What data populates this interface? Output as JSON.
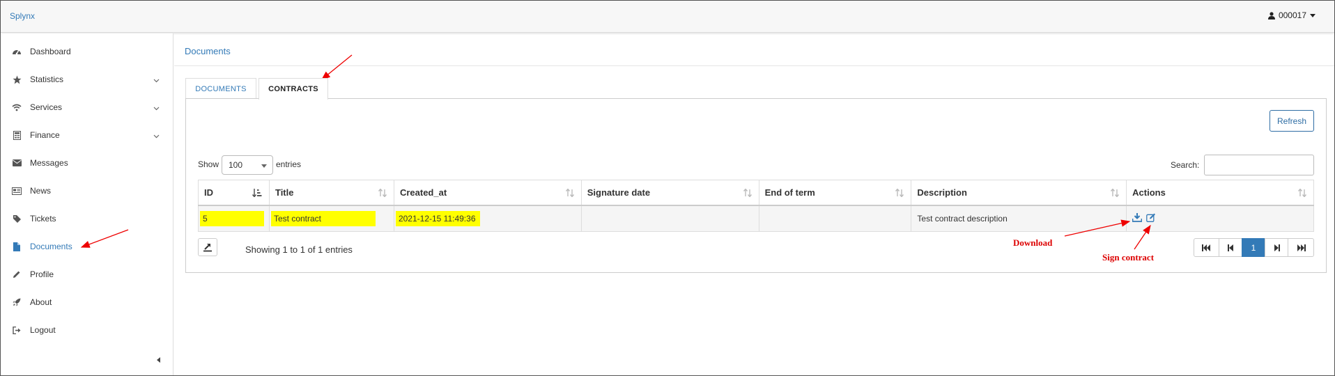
{
  "app": {
    "brand": "Splynx",
    "user": "000017"
  },
  "sidebar": {
    "items": [
      {
        "label": "Dashboard",
        "icon": "dashboard-icon",
        "has_submenu": false
      },
      {
        "label": "Statistics",
        "icon": "star-icon",
        "has_submenu": true
      },
      {
        "label": "Services",
        "icon": "wifi-icon",
        "has_submenu": true
      },
      {
        "label": "Finance",
        "icon": "calculator-icon",
        "has_submenu": true
      },
      {
        "label": "Messages",
        "icon": "envelope-icon",
        "has_submenu": false
      },
      {
        "label": "News",
        "icon": "newspaper-icon",
        "has_submenu": false
      },
      {
        "label": "Tickets",
        "icon": "tag-icon",
        "has_submenu": false
      },
      {
        "label": "Documents",
        "icon": "file-icon",
        "has_submenu": false,
        "active": true
      },
      {
        "label": "Profile",
        "icon": "pencil-icon",
        "has_submenu": false
      },
      {
        "label": "About",
        "icon": "rocket-icon",
        "has_submenu": false
      },
      {
        "label": "Logout",
        "icon": "sign-out-icon",
        "has_submenu": false
      }
    ]
  },
  "main": {
    "breadcrumb": "Documents",
    "tabs": [
      {
        "label": "DOCUMENTS",
        "active": false
      },
      {
        "label": "CONTRACTS",
        "active": true
      }
    ],
    "refresh_label": "Refresh",
    "length": {
      "show": "Show",
      "value": "100",
      "entries": "entries"
    },
    "search_label": "Search:",
    "table": {
      "columns": [
        "ID",
        "Title",
        "Created_at",
        "Signature date",
        "End of term",
        "Description",
        "Actions"
      ],
      "rows": [
        {
          "id": "5",
          "title": "Test contract",
          "created_at": "2021-12-15 11:49:36",
          "signature_date": "",
          "end_of_term": "",
          "description": "Test contract description"
        }
      ]
    },
    "info": "Showing 1 to 1 of 1 entries",
    "pagination": {
      "current": "1"
    }
  },
  "annotations": {
    "download": "Download",
    "sign": "Sign contract",
    "color": "#dd0000"
  },
  "colors": {
    "link": "#337ab7",
    "highlight": "#ffff00"
  }
}
